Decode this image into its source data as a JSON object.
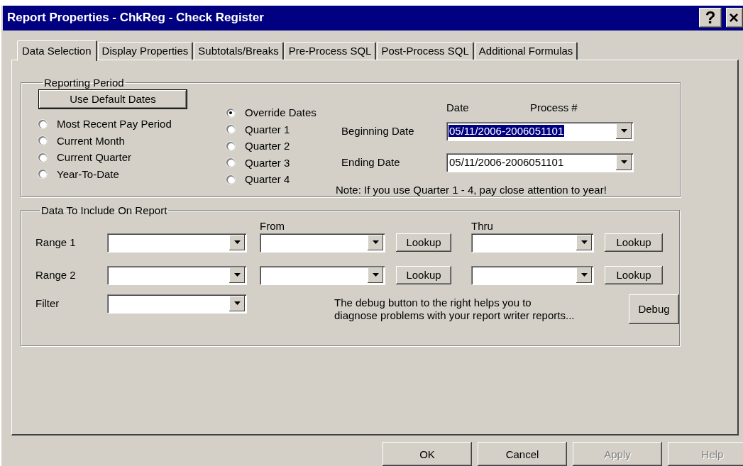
{
  "window": {
    "title": "Report Properties - ChkReg - Check Register",
    "help_button": "?",
    "close_button": "×"
  },
  "tabs": [
    {
      "label": "Data Selection",
      "selected": true
    },
    {
      "label": "Display Properties",
      "selected": false
    },
    {
      "label": "Subtotals/Breaks",
      "selected": false
    },
    {
      "label": "Pre-Process SQL",
      "selected": false
    },
    {
      "label": "Post-Process SQL",
      "selected": false
    },
    {
      "label": "Additional Formulas",
      "selected": false
    }
  ],
  "reporting_period": {
    "title": "Reporting Period",
    "default_button": "Use Default Dates",
    "radio_columns": [
      {
        "options": [
          {
            "label": "Most Recent Pay Period",
            "selected": false
          },
          {
            "label": "Current Month",
            "selected": false
          },
          {
            "label": "Current Quarter",
            "selected": false
          },
          {
            "label": "Year-To-Date",
            "selected": false
          }
        ]
      },
      {
        "options": [
          {
            "label": "Override Dates",
            "selected": true
          },
          {
            "label": "Quarter 1",
            "selected": false
          },
          {
            "label": "Quarter 2",
            "selected": false
          },
          {
            "label": "Quarter 3",
            "selected": false
          },
          {
            "label": "Quarter 4",
            "selected": false
          }
        ]
      }
    ],
    "date_headers": [
      "Date",
      "Process #"
    ],
    "dates": [
      {
        "label": "Beginning Date",
        "value": "05/11/2006-2006051101",
        "highlighted": true
      },
      {
        "label": "Ending Date",
        "value": "05/11/2006-2006051101",
        "highlighted": false
      }
    ],
    "note": "Note:  If you use Quarter 1 - 4, pay close attention to year!"
  },
  "data_to_include": {
    "title": "Data To Include On Report",
    "from_header": "From",
    "thru_header": "Thru",
    "ranges": [
      {
        "label": "Range 1",
        "lookup_from": "Lookup",
        "lookup_thru": "Lookup"
      },
      {
        "label": "Range 2",
        "lookup_from": "Lookup",
        "lookup_thru": "Lookup"
      }
    ],
    "filter_label": "Filter",
    "debug_note_lines": [
      "The debug button to the right helps you to",
      "diagnose problems with your report writer reports..."
    ],
    "debug_button": "Debug"
  },
  "buttons": [
    {
      "label": "OK",
      "disabled": false
    },
    {
      "label": "Cancel",
      "disabled": false
    },
    {
      "label": "Apply",
      "disabled": true
    },
    {
      "label": "Help",
      "disabled": true
    }
  ]
}
